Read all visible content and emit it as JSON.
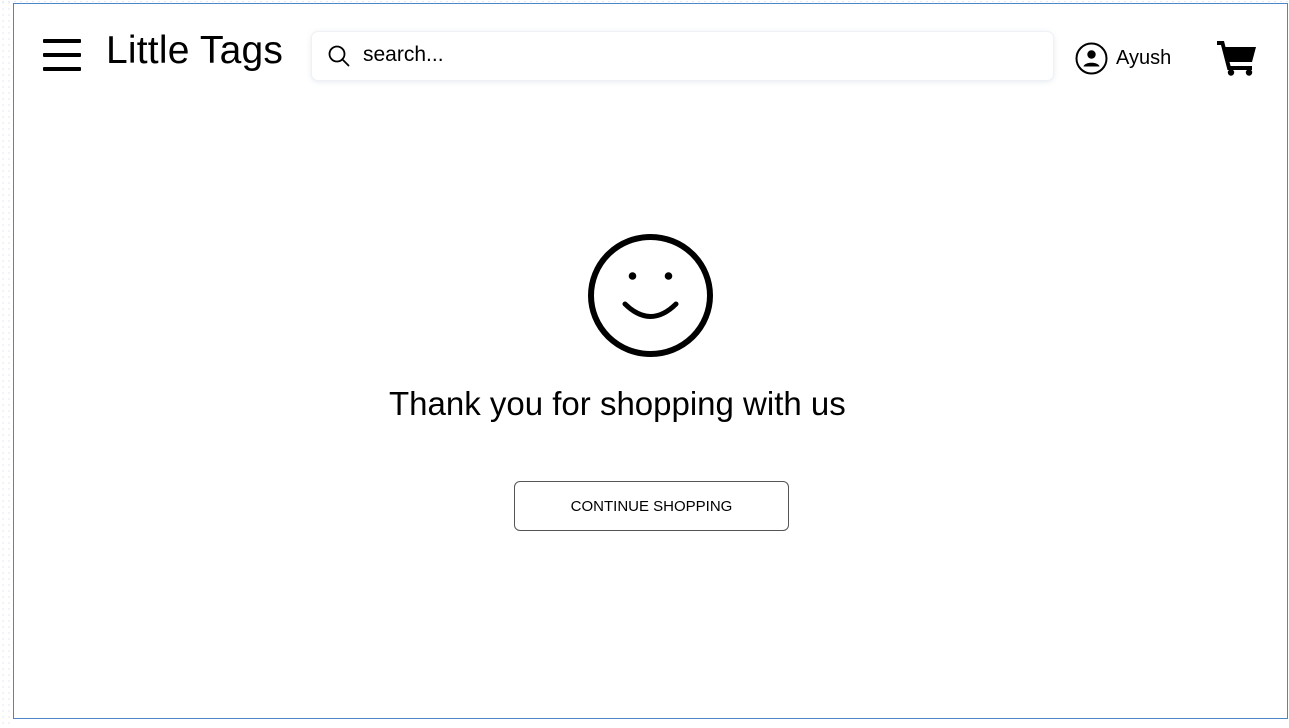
{
  "header": {
    "brand": "Little Tags",
    "search_placeholder": "search...",
    "user_name": "Ayush"
  },
  "main": {
    "message": "Thank you for shopping with us",
    "cta_label": "CONTINUE SHOPPING"
  },
  "icons": {
    "menu": "hamburger-menu-icon",
    "search": "search-icon",
    "user": "user-circle-icon",
    "cart": "shopping-cart-icon",
    "smiley": "smiley-face-icon"
  },
  "colors": {
    "frame_border": "#4a86c8",
    "text": "#000000",
    "background": "#ffffff"
  }
}
